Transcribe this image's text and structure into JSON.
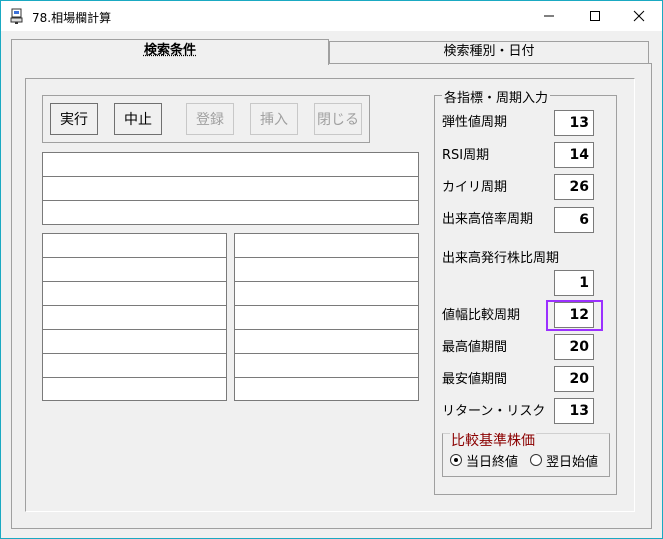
{
  "window": {
    "title": "78.相場欄計算"
  },
  "tabs": [
    {
      "label": "検索条件",
      "active": true
    },
    {
      "label": "検索種別・日付",
      "active": false
    }
  ],
  "toolbar": {
    "execute_label": "実行",
    "stop_label": "中止",
    "register_label": "登録",
    "insert_label": "挿入",
    "close_label": "閉じる"
  },
  "indicators": {
    "group_title": "各指標・周期入力",
    "items": [
      {
        "label": "弾性値周期",
        "value": "13"
      },
      {
        "label": "RSI周期",
        "value": "14"
      },
      {
        "label": "カイリ周期",
        "value": "26"
      },
      {
        "label": "出来高倍率周期",
        "value": "6"
      },
      {
        "label": "出来高発行株比周期",
        "value": "1"
      },
      {
        "label": "値幅比較周期",
        "value": "12"
      },
      {
        "label": "最高値期間",
        "value": "20"
      },
      {
        "label": "最安値期間",
        "value": "20"
      },
      {
        "label": "リターン・リスク",
        "value": "13"
      }
    ]
  },
  "price_basis": {
    "title": "比較基準株価",
    "options": [
      {
        "label": "当日終値",
        "checked": true
      },
      {
        "label": "翌日始値",
        "checked": false
      }
    ]
  }
}
